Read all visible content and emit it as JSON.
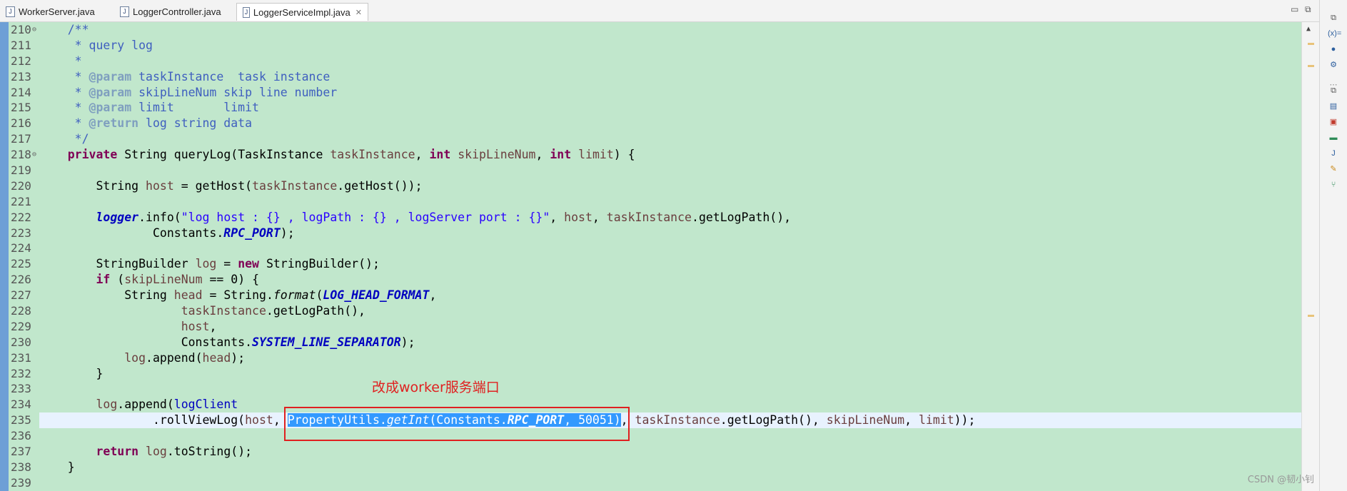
{
  "tabs": [
    {
      "label": "WorkerServer.java",
      "active": false
    },
    {
      "label": "LoggerController.java",
      "active": false
    },
    {
      "label": "LoggerServiceImpl.java",
      "active": true
    }
  ],
  "line_numbers": [
    "210",
    "211",
    "212",
    "213",
    "214",
    "215",
    "216",
    "217",
    "218",
    "219",
    "220",
    "221",
    "222",
    "223",
    "224",
    "225",
    "226",
    "227",
    "228",
    "229",
    "230",
    "231",
    "232",
    "233",
    "234",
    "235",
    "236",
    "237",
    "238",
    "239"
  ],
  "annotation": "改成worker服务端口",
  "watermark": "CSDN @韧小钊",
  "colors": {
    "editor_bg": "#c1e7cc",
    "current_line": "#e8f2fe",
    "selection": "#3399ff",
    "annotation_red": "#e02020"
  },
  "code": {
    "l210": "/**",
    "l211": " * query log",
    "l212": " *",
    "l213_tag": "@param",
    "l213_txt": " taskInstance  task instance",
    "l214_tag": "@param",
    "l214_txt": " skipLineNum skip line number",
    "l215_tag": "@param",
    "l215_txt": " limit       limit",
    "l216_tag": "@return",
    "l216_txt": " log string data",
    "l217": " */",
    "kw_private": "private",
    "t_String": "String",
    "m_queryLog": "queryLog",
    "t_TaskInstance": "TaskInstance",
    "v_taskInstance": "taskInstance",
    "kw_int": "int",
    "v_skipLineNum": "skipLineNum",
    "v_limit": "limit",
    "v_host": "host",
    "m_getHost": "getHost",
    "m_getHost2": "getHost",
    "logger": "logger",
    "m_info": "info",
    "s_log": "\"log host : {} , logPath : {} , logServer port : {}\"",
    "m_getLogPath": "getLogPath",
    "t_Constants": "Constants",
    "f_RPC_PORT": "RPC_PORT",
    "t_StringBuilder": "StringBuilder",
    "v_log": "log",
    "kw_new": "new",
    "kw_if": "if",
    "n_zero": "0",
    "v_head": "head",
    "m_format": "format",
    "f_LOG_HEAD_FORMAT": "LOG_HEAD_FORMAT",
    "f_SYSTEM_LINE_SEPARATOR": "SYSTEM_LINE_SEPARATOR",
    "m_append": "append",
    "v_logClient": "logClient",
    "m_rollViewLog": "rollViewLog",
    "t_PropertyUtils": "PropertyUtils",
    "m_getInt": "getInt",
    "n_50051": "50051",
    "kw_return": "return",
    "m_toString": "toString"
  }
}
